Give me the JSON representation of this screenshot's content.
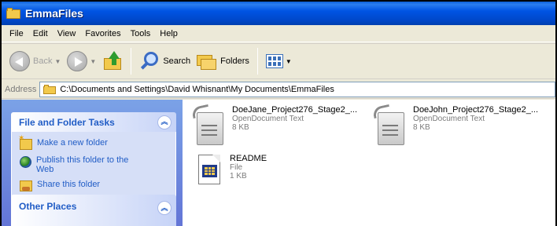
{
  "window": {
    "title": "EmmaFiles",
    "icon": "folder-icon"
  },
  "menu": [
    "File",
    "Edit",
    "View",
    "Favorites",
    "Tools",
    "Help"
  ],
  "toolbar": {
    "back_label": "Back",
    "search_label": "Search",
    "folders_label": "Folders"
  },
  "address": {
    "label": "Address",
    "path": "C:\\Documents and Settings\\David Whisnant\\My Documents\\EmmaFiles"
  },
  "tasks": {
    "file_folder_title": "File and Folder Tasks",
    "collapse_glyph": "︽",
    "items": [
      {
        "label": "Make a new folder",
        "icon": "new-folder-icon"
      },
      {
        "label": "Publish this folder to the Web",
        "icon": "globe-icon"
      },
      {
        "label": "Share this folder",
        "icon": "share-folder-icon"
      }
    ],
    "other_places_title": "Other Places"
  },
  "files": [
    {
      "name": "DoeJane_Project276_Stage2_...",
      "type": "OpenDocument Text",
      "size": "8 KB",
      "icon": "odt-document-icon"
    },
    {
      "name": "DoeJohn_Project276_Stage2_...",
      "type": "OpenDocument Text",
      "size": "8 KB",
      "icon": "odt-document-icon"
    },
    {
      "name": "README",
      "type": "File",
      "size": "1 KB",
      "icon": "generic-file-icon"
    }
  ]
}
